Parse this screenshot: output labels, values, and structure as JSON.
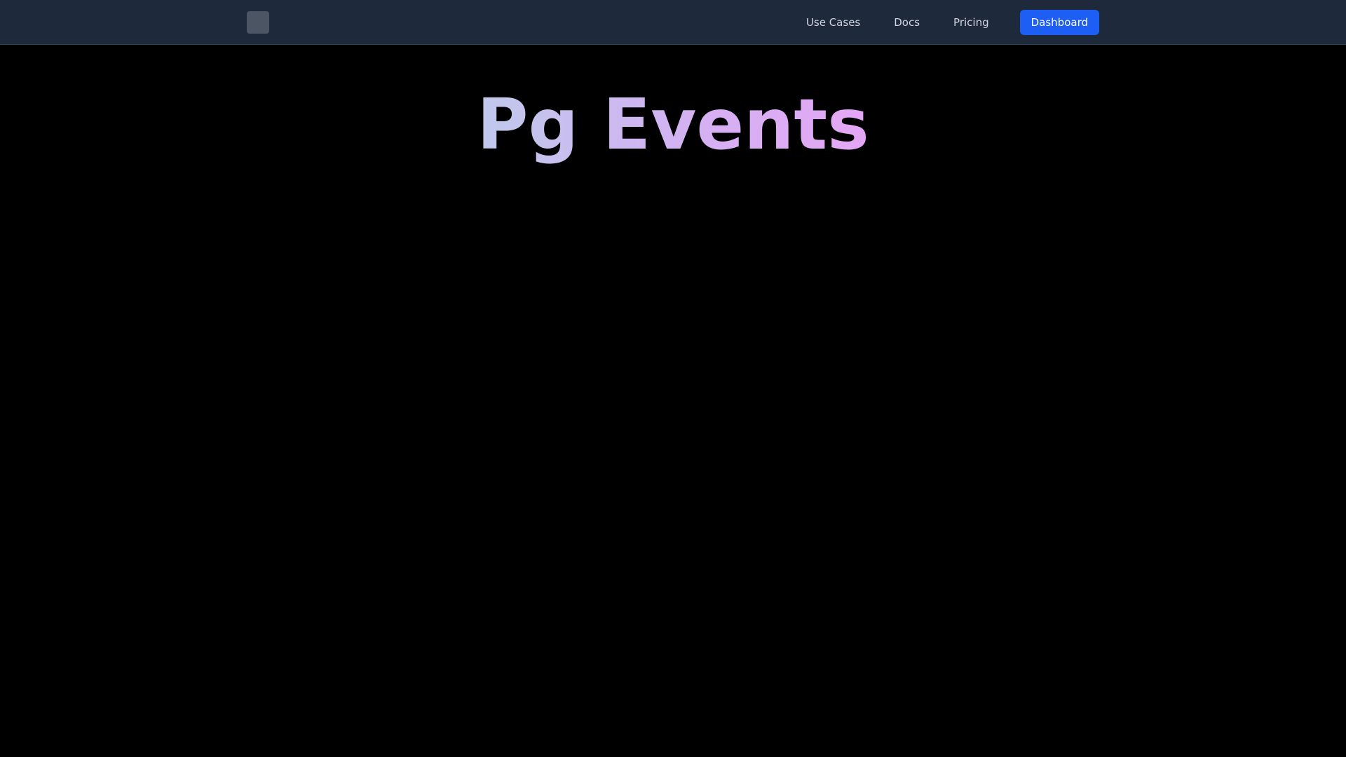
{
  "nav": {
    "links": [
      "Use Cases",
      "Docs",
      "Pricing"
    ],
    "cta_label": "Dashboard"
  },
  "hero": {
    "title": "Pg Events"
  },
  "colors": {
    "navbar_bg": "#1e293b",
    "page_bg": "#000000",
    "cta_bg": "#1d5ff5",
    "title_gradient_start": "#c0c9ec",
    "title_gradient_end": "#e4a6f5"
  }
}
